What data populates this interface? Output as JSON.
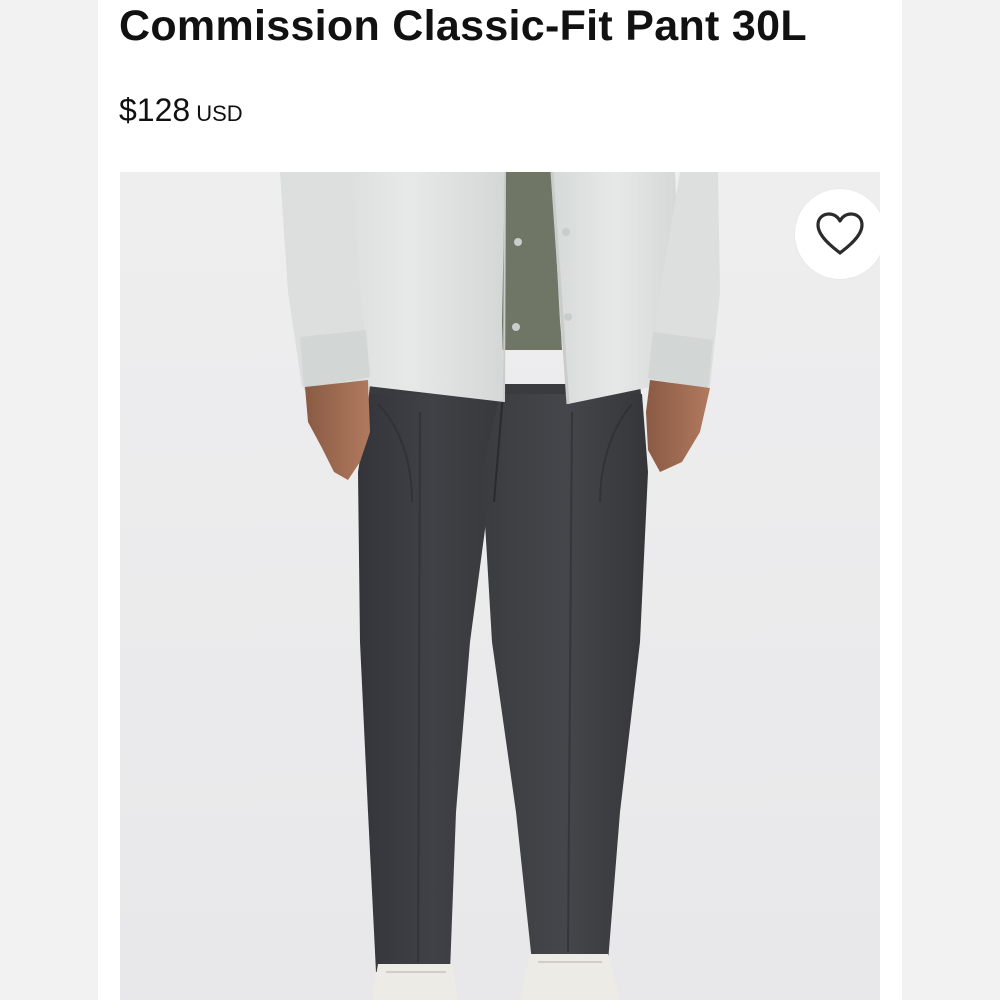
{
  "product": {
    "title": "Commission Classic-Fit Pant 30L",
    "price": "$128",
    "currency": "USD"
  },
  "image": {
    "alt": "Model wearing dark grey Commission Classic-Fit Pant with a light grey shirt",
    "pant_color": "#3a3b3e",
    "shirt_color": "#e1e4e2",
    "background_color": "#eeeeef"
  },
  "wishlist": {
    "icon": "heart-outline-icon"
  },
  "colors": {
    "text": "#111111",
    "card": "#ffffff",
    "page": "#f2f2f2"
  }
}
